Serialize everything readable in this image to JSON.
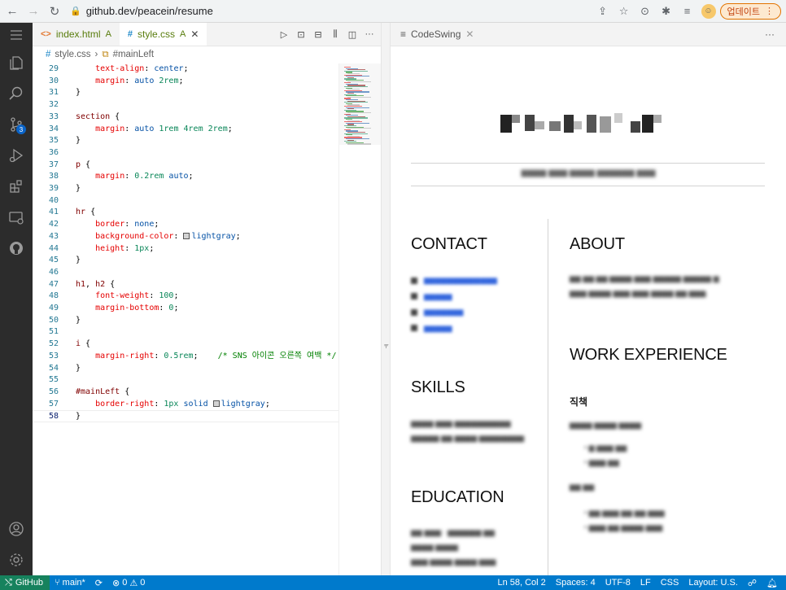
{
  "browser": {
    "url": "github.dev/peacein/resume",
    "update_label": "업데이트"
  },
  "activity_bar": {
    "items": [
      "explorer-icon",
      "search-icon",
      "source-control-icon",
      "run-debug-icon",
      "extensions-icon",
      "remote-explorer-icon",
      "github-icon"
    ],
    "scm_badge": "3",
    "bottom": [
      "account-icon",
      "settings-gear-icon"
    ]
  },
  "editor": {
    "tabs": [
      {
        "label": "index.html",
        "status": "A",
        "icon": "<>"
      },
      {
        "label": "style.css",
        "status": "A",
        "icon": "#",
        "active": true
      }
    ],
    "breadcrumb": {
      "file": "style.css",
      "symbol": "#mainLeft"
    },
    "code_lines": [
      {
        "n": "29",
        "html": "    <span class='prop'>text-align</span>: <span class='val'>center</span>;"
      },
      {
        "n": "30",
        "html": "    <span class='prop'>margin</span>: <span class='val'>auto</span> <span class='num'>2rem</span>;"
      },
      {
        "n": "31",
        "html": "}"
      },
      {
        "n": "32",
        "html": ""
      },
      {
        "n": "33",
        "html": "<span class='sel'>section</span> {"
      },
      {
        "n": "34",
        "html": "    <span class='prop'>margin</span>: <span class='val'>auto</span> <span class='num'>1rem</span> <span class='num'>4rem</span> <span class='num'>2rem</span>;"
      },
      {
        "n": "35",
        "html": "}"
      },
      {
        "n": "36",
        "html": ""
      },
      {
        "n": "37",
        "html": "<span class='sel'>p</span> {"
      },
      {
        "n": "38",
        "html": "    <span class='prop'>margin</span>: <span class='num'>0.2rem</span> <span class='val'>auto</span>;"
      },
      {
        "n": "39",
        "html": "}"
      },
      {
        "n": "40",
        "html": ""
      },
      {
        "n": "41",
        "html": "<span class='sel'>hr</span> {"
      },
      {
        "n": "42",
        "html": "    <span class='prop'>border</span>: <span class='val'>none</span>;"
      },
      {
        "n": "43",
        "html": "    <span class='prop'>background-color</span>: <span class='swatch'></span><span class='val'>lightgray</span>;"
      },
      {
        "n": "44",
        "html": "    <span class='prop'>height</span>: <span class='num'>1px</span>;"
      },
      {
        "n": "45",
        "html": "}"
      },
      {
        "n": "46",
        "html": ""
      },
      {
        "n": "47",
        "html": "<span class='sel'>h1</span>, <span class='sel'>h2</span> {"
      },
      {
        "n": "48",
        "html": "    <span class='prop'>font-weight</span>: <span class='num'>100</span>;"
      },
      {
        "n": "49",
        "html": "    <span class='prop'>margin-bottom</span>: <span class='num'>0</span>;"
      },
      {
        "n": "50",
        "html": "}"
      },
      {
        "n": "51",
        "html": ""
      },
      {
        "n": "52",
        "html": "<span class='sel'>i</span> {"
      },
      {
        "n": "53",
        "html": "    <span class='prop'>margin-right</span>: <span class='num'>0.5rem</span>;    <span class='cmt'>/* SNS 아이콘 오른쪽 여백 */</span>"
      },
      {
        "n": "54",
        "html": "}"
      },
      {
        "n": "55",
        "html": ""
      },
      {
        "n": "56",
        "html": "<span class='sel'>#mainLeft</span> {"
      },
      {
        "n": "57",
        "html": "    <span class='prop'>border-right</span>: <span class='num'>1px</span> <span class='val'>solid</span> <span class='swatch'></span><span class='val'>lightgray</span>;"
      },
      {
        "n": "58",
        "html": "}"
      }
    ],
    "current_line": "58"
  },
  "preview": {
    "tab_label": "CodeSwing",
    "headings": {
      "contact": "CONTACT",
      "about": "ABOUT",
      "work": "WORK EXPERIENCE",
      "skills": "SKILLS",
      "education": "EDUCATION",
      "job_title": "직책"
    }
  },
  "statusbar": {
    "remote": "GitHub",
    "branch": "main*",
    "errors": "0",
    "warnings": "0",
    "position": "Ln 58, Col 2",
    "spaces": "Spaces: 4",
    "encoding": "UTF-8",
    "eol": "LF",
    "language": "CSS",
    "layout": "Layout: U.S."
  },
  "colors": {
    "activity_bar": "#2c2c2c",
    "status_bar": "#007acc",
    "remote_indicator": "#16825d"
  }
}
